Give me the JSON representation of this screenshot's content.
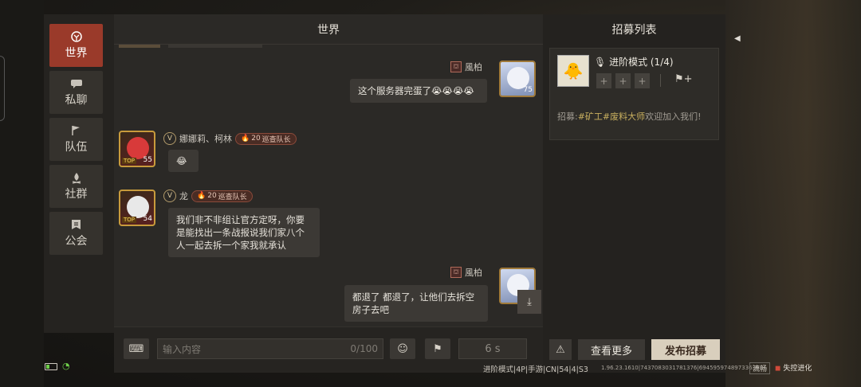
{
  "sidebar": {
    "items": [
      {
        "label": "世界",
        "icon": "globe-icon"
      },
      {
        "label": "私聊",
        "icon": "chat-bubble-icon"
      },
      {
        "label": "队伍",
        "icon": "flag-icon"
      },
      {
        "label": "社群",
        "icon": "campfire-icon"
      },
      {
        "label": "公会",
        "icon": "banner-icon"
      }
    ]
  },
  "chat": {
    "title": "世界",
    "messages": [
      {
        "name": "風柏",
        "side": "right",
        "text": "这个服务器完蛋了😭😭😭😭",
        "level": "75"
      },
      {
        "name": "娜娜莉、柯林",
        "vip": "V",
        "badge_num": "20",
        "badge_text": "巡查队长",
        "side": "left",
        "text": "😂",
        "tag": "TOP",
        "level": "55"
      },
      {
        "name": "龙",
        "vip": "V",
        "badge_num": "20",
        "badge_text": "巡查队长",
        "side": "left",
        "text": "我们非不非组让官方定呀，你要是能找出一条战报说我们家八个人一起去拆一个家我就承认",
        "tag": "TOP",
        "level": "54"
      },
      {
        "name": "風柏",
        "side": "right",
        "text": "都退了 都退了，让他们去拆空房子去吧",
        "level": ""
      }
    ],
    "input_placeholder": "输入内容",
    "char_count": "0/100",
    "send_label": "6 s"
  },
  "recruit": {
    "title": "招募列表",
    "mode": "进阶模式 (1/4)",
    "text_prefix": "招募:",
    "text_tags": "#矿工#废料大师",
    "text_suffix": "欢迎加入我们!",
    "slots": [
      "+",
      "+",
      "+"
    ],
    "more_label": "查看更多",
    "post_label": "发布招募"
  },
  "status": {
    "info": "进阶模式|4P|手游|CN|54|4|S3",
    "version": "1.96.23.1610|7437083031781376|69459597489733634",
    "smooth": "流畅",
    "logo": "失控进化"
  }
}
